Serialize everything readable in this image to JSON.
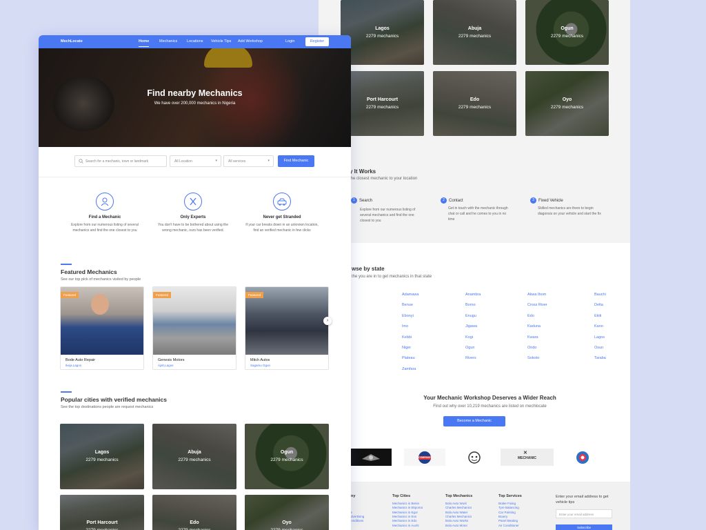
{
  "colors": {
    "accent": "#4a78f2",
    "badge": "#f0a04b",
    "backdrop": "#d7dcf5"
  },
  "nav": {
    "logo": "MechLocate",
    "items": [
      "Home",
      "Mechanics",
      "Locations",
      "Vehicle Tips",
      "Add Workshop"
    ],
    "login": "Login",
    "register": "Register"
  },
  "hero": {
    "title": "Find nearby Mechanics",
    "subtitle": "We have over 200,000 mechanics in Nigeria"
  },
  "search": {
    "placeholder": "Search for a mechanic, town or landmark",
    "location": "All Location",
    "services": "All services",
    "button": "Find Mechanic"
  },
  "features": [
    {
      "icon": "mechanic-icon",
      "title": "Find a Mechanic",
      "desc": "Explore from our numerous listing of several mechanics and find the one closest to you"
    },
    {
      "icon": "tools-icon",
      "title": "Only Experts",
      "desc": "You don't have to be bothered about using the wrong mechanic, ours has been verified."
    },
    {
      "icon": "car-repair-icon",
      "title": "Never get Stranded",
      "desc": "If your car breaks down in an unknown location, find an verified mechanic in few clicks"
    }
  ],
  "featured": {
    "title": "Featured Mechanics",
    "subtitle": "See our top pick of mechanics visited by people",
    "badge": "Featured",
    "cards": [
      {
        "name": "Bode Auto Repair",
        "location": "Ikeja,Lagos"
      },
      {
        "name": "Genesis Motors",
        "location": "Ajah,Lagos"
      },
      {
        "name": "Mitch Autos",
        "location": "Sagamu Ogun"
      }
    ]
  },
  "popular": {
    "title": "Popular cities with verified mechanics",
    "subtitle": "See the top destinations people are request mechanics",
    "cities": [
      {
        "name": "Lagos",
        "count": "2279 mechanics"
      },
      {
        "name": "Abuja",
        "count": "2279 mechanics"
      },
      {
        "name": "Ogun",
        "count": "2279 mechanics"
      },
      {
        "name": "Port Harcourt",
        "count": "2279 mechanics"
      },
      {
        "name": "Edo",
        "count": "2279 mechanics"
      },
      {
        "name": "Oyo",
        "count": "2279 mechanics"
      }
    ]
  },
  "how": {
    "title": "y It Works",
    "subtitle": "the closest mechanic to your location",
    "steps": [
      {
        "num": "1",
        "title": "Search",
        "desc": "Explore from our numerous listing of several mechanics and find the one closest to you"
      },
      {
        "num": "2",
        "title": "Contact",
        "desc": "Get in touch with the mechanic through chat or call and he comes to you in no time"
      },
      {
        "num": "3",
        "title": "Fixed Vehicle",
        "desc": "Skilled mechanics are there to begin diagonsis on your vehicle and start the fix"
      }
    ]
  },
  "browse": {
    "title": "wse by state",
    "subtitle": "the you are in to get mechanics in that state",
    "states": [
      [
        "Adamawa",
        "Benue",
        "Ebonyi",
        "Imo",
        "Kebbi",
        "Niger",
        "Plateau",
        "Zamfara"
      ],
      [
        "Anambra",
        "Borno",
        "Enugu",
        "Jigawa",
        "Kogi",
        "Ogun",
        "Rivers"
      ],
      [
        "Akwa Ibom",
        "Cross River",
        "Edo",
        "Kaduna",
        "Kwara",
        "Ondo",
        "Sokoto"
      ],
      [
        "Bauchi",
        "Delta",
        "Ekiti",
        "Kano",
        "Lagos",
        "Osun",
        "Taraba"
      ]
    ]
  },
  "cta": {
    "title": "Your Mechanic Workshop Deserves a Wider Reach",
    "subtitle": "Find out why over 10,219 mechanics are listed on mechlocate",
    "button": "Become a Mechanic"
  },
  "logos": [
    "auto-logo",
    "company-logo",
    "mascot-logo",
    "mechanic-logo",
    "badge-logo"
  ],
  "logo_text": {
    "company": "COMPANY",
    "mechanic": "MECHANIC"
  },
  "footer": {
    "col1_title": "any",
    "col1": [
      "",
      "s",
      "gs",
      "Advertising",
      "Conditions"
    ],
    "top_cities": {
      "title": "Top Cities",
      "items": [
        "Mechanics in Benin",
        "Mechanics in Ekpoma",
        "Mechanics in Egor",
        "Mechanics in Esn",
        "Mechanics in Edo",
        "Mechanics in Auchi"
      ]
    },
    "top_mechanics": {
      "title": "Top Mechanics",
      "items": [
        "Bola Auto Work",
        "Charles Mechanics",
        "Bola Auto Water",
        "Charles Mechanics",
        "Bola Auto Works",
        "Bola Auto Motor"
      ]
    },
    "top_services": {
      "title": "Top Services",
      "items": [
        "Brake Fixing",
        "Tyre Balancing",
        "Car Painting",
        "Boarry",
        "Panel Beating",
        "Air Conditioner"
      ]
    },
    "newsletter": {
      "text": "Enter your email address to get vehicle tips",
      "placeholder": "Enter your email address",
      "button": "Subscribe"
    }
  }
}
